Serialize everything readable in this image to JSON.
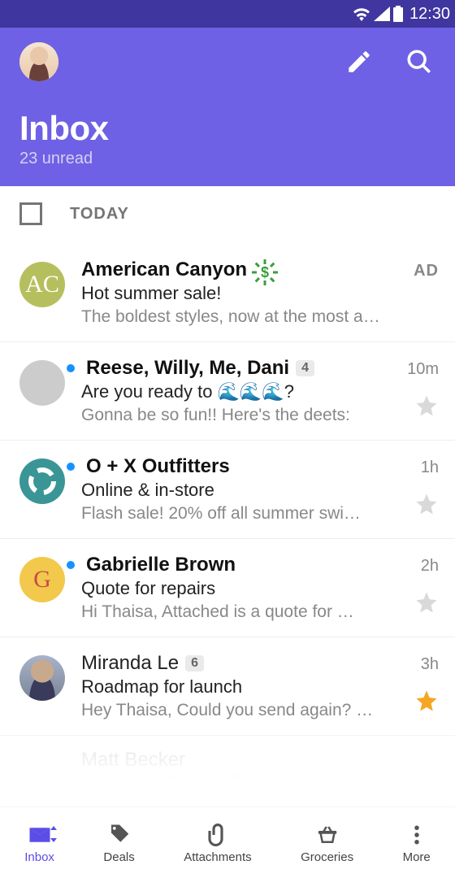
{
  "status": {
    "time": "12:30"
  },
  "header": {
    "title": "Inbox",
    "subtitle": "23 unread"
  },
  "section": {
    "label": "TODAY"
  },
  "rows": [
    {
      "sender": "American Canyon",
      "subject": "Hot summer sale!",
      "snippet": "The boldest styles, now at the most adv…",
      "time": "AD",
      "avatar_text": "AC",
      "avatar_bg": "#b6bf5e",
      "unread": false,
      "is_ad": true,
      "starred": false,
      "show_star": false,
      "has_dollar": true
    },
    {
      "sender": "Reese, Willy, Me, Dani",
      "count": "4",
      "subject": "Are you ready to  🌊🌊🌊?",
      "snippet": "Gonna be so fun!! Here's the deets:",
      "time": "10m",
      "avatar_type": "grid",
      "unread": true,
      "starred": false,
      "show_star": true
    },
    {
      "sender": "O + X Outfitters",
      "subject": "Online & in-store",
      "snippet": "Flash sale! 20% off all summer swi…",
      "time": "1h",
      "avatar_bg": "#3a9596",
      "avatar_svg": "ring",
      "unread": true,
      "starred": false,
      "show_star": true
    },
    {
      "sender": "Gabrielle Brown",
      "subject": "Quote for repairs",
      "snippet": "Hi Thaisa, Attached is a quote for …",
      "time": "2h",
      "avatar_text": "G",
      "avatar_bg": "#f2c94c",
      "avatar_fg": "#c94b4b",
      "unread": true,
      "starred": false,
      "show_star": true
    },
    {
      "sender": "Miranda Le",
      "count": "6",
      "subject": "Roadmap for launch",
      "snippet": "Hey Thaisa, Could you send again? …",
      "time": "3h",
      "avatar_type": "photo",
      "unread": false,
      "starred": true,
      "show_star": true
    }
  ],
  "ghost": {
    "sender": "Matt Becker",
    "subject": "Hotels for Orlando Trip"
  },
  "nav": {
    "items": [
      {
        "label": "Inbox",
        "icon": "mail",
        "active": true
      },
      {
        "label": "Deals",
        "icon": "tag"
      },
      {
        "label": "Attachments",
        "icon": "clip"
      },
      {
        "label": "Groceries",
        "icon": "basket"
      },
      {
        "label": "More",
        "icon": "more"
      }
    ]
  }
}
